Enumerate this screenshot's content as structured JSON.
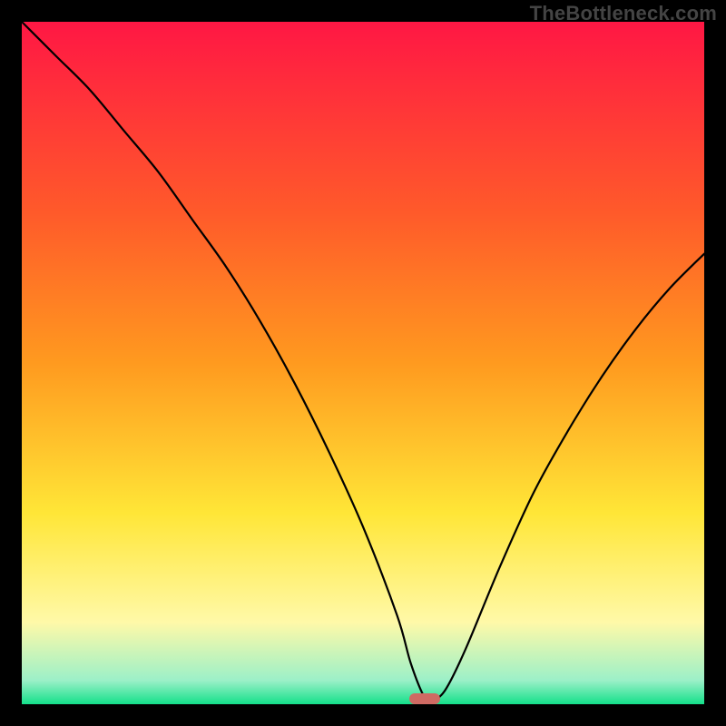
{
  "watermark": "TheBottleneck.com",
  "chart_data": {
    "type": "line",
    "title": "",
    "xlabel": "",
    "ylabel": "",
    "xlim": [
      0,
      100
    ],
    "ylim": [
      0,
      100
    ],
    "grid": false,
    "legend": false,
    "gradient_bands": [
      {
        "name": "red",
        "color": "#ff1744",
        "stop": 0.0
      },
      {
        "name": "red-orange",
        "color": "#ff5a2a",
        "stop": 0.28
      },
      {
        "name": "orange",
        "color": "#ff9a1f",
        "stop": 0.5
      },
      {
        "name": "yellow",
        "color": "#ffe637",
        "stop": 0.72
      },
      {
        "name": "pale-yellow",
        "color": "#fff9a8",
        "stop": 0.88
      },
      {
        "name": "mint",
        "color": "#9cf0c8",
        "stop": 0.965
      },
      {
        "name": "green",
        "color": "#14e08a",
        "stop": 1.0
      }
    ],
    "series": [
      {
        "name": "bottleneck-curve",
        "stroke": "#000000",
        "stroke_width": 2.2,
        "x": [
          0,
          5,
          10,
          15,
          20,
          25,
          30,
          35,
          40,
          45,
          50,
          55,
          57,
          59,
          60,
          62,
          65,
          70,
          75,
          80,
          85,
          90,
          95,
          100
        ],
        "y": [
          100,
          95,
          90,
          84,
          78,
          71,
          64,
          56,
          47,
          37,
          26,
          13,
          6,
          1,
          0.5,
          2,
          8,
          20,
          31,
          40,
          48,
          55,
          61,
          66
        ]
      }
    ],
    "marker": {
      "x_center": 59,
      "width_pct": 4.5,
      "color": "#cf6a63"
    }
  }
}
